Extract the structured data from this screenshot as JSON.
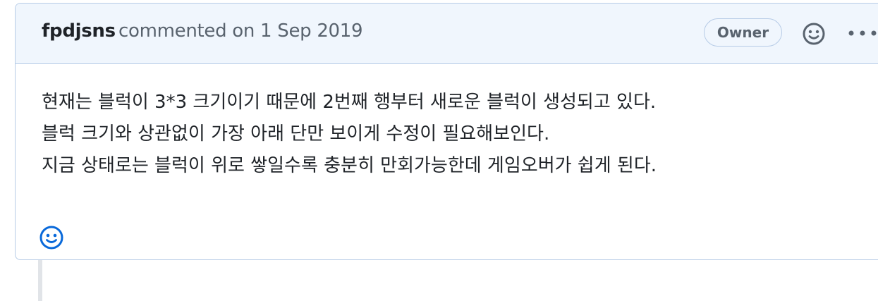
{
  "comment": {
    "author": "fpdjsns",
    "meta": "commented on 1 Sep 2019",
    "badge": "Owner",
    "body_lines": [
      "현재는 블럭이 3*3 크기이기 때문에 2번째 행부터 새로운 블럭이 생성되고 있다.",
      "블럭 크기와 상관없이 가장 아래 단만 보이게 수정이 필요해보인다.",
      "지금 상태로는 블럭이 위로 쌓일수록 충분히 만회가능한데 게임오버가 쉽게 된다."
    ]
  },
  "icons": {
    "header_reaction": "smiley-icon",
    "more": "kebab-horizontal-icon",
    "footer_reaction": "smiley-icon"
  },
  "colors": {
    "header_bg": "#f0f6fd",
    "border": "#b6cbe6",
    "text": "#1f2328",
    "muted": "#59636e",
    "accent": "#0969da"
  }
}
